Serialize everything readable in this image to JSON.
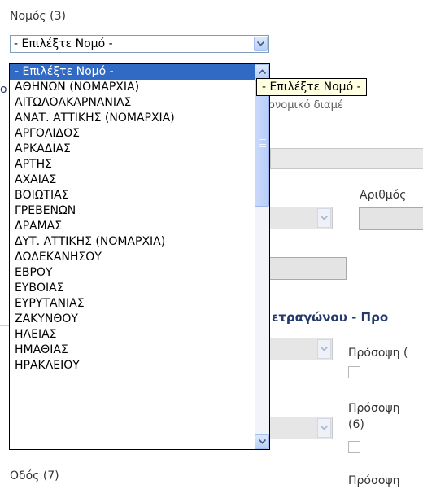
{
  "county_label": "Νομός (3)",
  "select": {
    "selected_value": "- Επιλέξτε Νομό -"
  },
  "dropdown_options": [
    "- Επιλέξτε Νομό -",
    "ΑΘΗΝΩΝ (ΝΟΜΑΡΧΙΑ)",
    "ΑΙΤΩΛΟΑΚΑΡΝΑΝΙΑΣ",
    "ΑΝΑΤ. ΑΤΤΙΚΗΣ (ΝΟΜΑΡΧΙΑ)",
    "ΑΡΓΟΛΙΔΟΣ",
    "ΑΡΚΑΔΙΑΣ",
    "ΑΡΤΗΣ",
    "ΑΧΑΙΑΣ",
    "ΒΟΙΩΤΙΑΣ",
    "ΓΡΕΒΕΝΩΝ",
    "ΔΡΑΜΑΣ",
    "ΔΥΤ. ΑΤΤΙΚΗΣ (ΝΟΜΑΡΧΙΑ)",
    "ΔΩΔΕΚΑΝΗΣΟΥ",
    "ΕΒΡΟΥ",
    "ΕΥΒΟΙΑΣ",
    "ΕΥΡΥΤΑΝΙΑΣ",
    "ΖΑΚΥΝΘΟΥ",
    "ΗΛΕΙΑΣ",
    "ΗΜΑΘΙΑΣ",
    "ΗΡΑΚΛΕΙΟΥ"
  ],
  "tooltip": "- Επιλέξτε Νομό -",
  "background": {
    "partial_blue_text": "ικονομικό διαμέ",
    "left_edge_char": "o",
    "number_label": "Αριθμός",
    "section_heading": "ετραγώνου - Προ",
    "frontage_label_1": "Πρόσοψη (",
    "frontage_label_2": "Πρόσοψη",
    "frontage_number_2": "(6)",
    "frontage_label_3": "Πρόσοψη",
    "street_label": "Οδός (7)"
  }
}
